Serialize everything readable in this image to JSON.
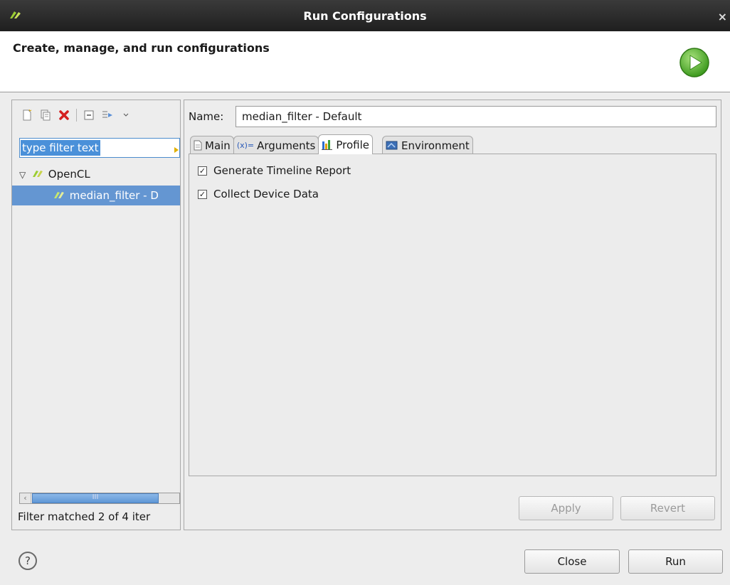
{
  "window": {
    "title": "Run Configurations",
    "close_glyph": "×"
  },
  "header": {
    "heading": "Create, manage, and run configurations"
  },
  "sidebar": {
    "toolbar_icons": [
      "new-config-icon",
      "duplicate-icon",
      "delete-icon",
      "collapse-all-icon",
      "filter-icon",
      "dropdown-icon"
    ],
    "filter_text": "type filter text",
    "tree": {
      "category": "OpenCL",
      "selected_item": "median_filter - D"
    },
    "scroll_grip": "III",
    "status": "Filter matched 2 of 4 iter"
  },
  "editor": {
    "name_label": "Name:",
    "name_value": "median_filter - Default",
    "tabs": [
      {
        "label": "Main",
        "icon": "document-icon"
      },
      {
        "label": "Arguments",
        "icon": "variable-icon"
      },
      {
        "label": "Profile",
        "icon": "bar-chart-icon"
      },
      {
        "label": "Environment",
        "icon": "environment-icon"
      }
    ],
    "active_tab": "Profile",
    "profile": {
      "checkboxes": [
        {
          "label": "Generate Timeline Report",
          "checked": true
        },
        {
          "label": "Collect Device Data",
          "checked": true
        }
      ]
    },
    "apply_label": "Apply",
    "revert_label": "Revert"
  },
  "footer": {
    "help_glyph": "?",
    "close_label": "Close",
    "run_label": "Run"
  },
  "colors": {
    "titlebar": "#2b2b2b",
    "selection": "#6496d2",
    "run_green": "#4caf2a"
  }
}
